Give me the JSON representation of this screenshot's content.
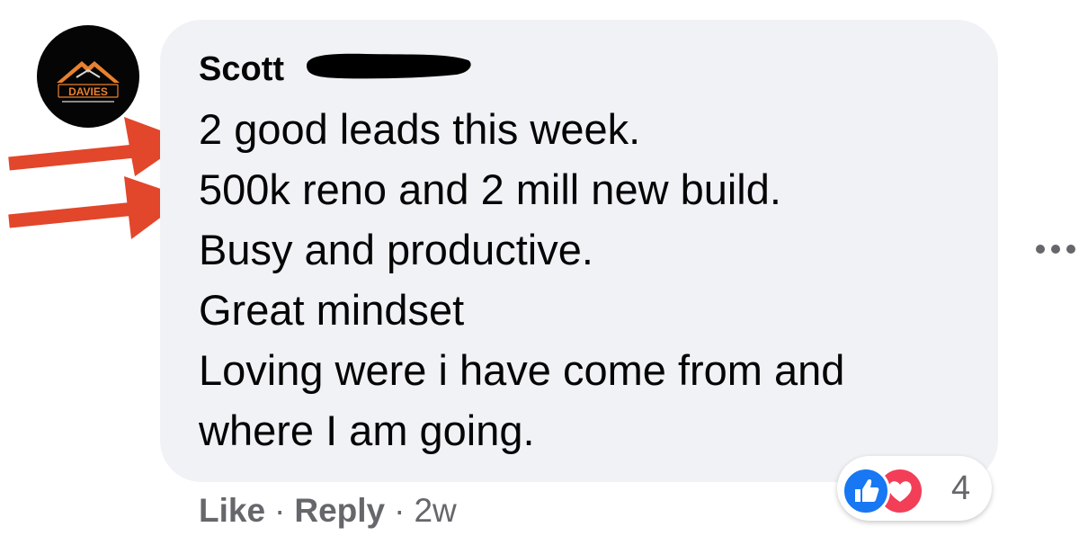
{
  "avatar": {
    "brand_text": "DAVIES",
    "brand_color": "#e8812f"
  },
  "comment": {
    "author": "Scott",
    "lines": [
      "2 good leads this week.",
      "500k reno and 2 mill new build.",
      "Busy and productive.",
      "Great mindset",
      "Loving were i have come from and",
      "where I am going."
    ]
  },
  "annotations": {
    "arrow_color": "#e2462b"
  },
  "actions": {
    "like": "Like",
    "separator": "·",
    "reply": "Reply",
    "time": "2w"
  },
  "reactions": {
    "like_color": "#1877f2",
    "love_color": "#f33e58",
    "count": "4"
  },
  "more_menu_icon": "ellipsis-icon",
  "colors": {
    "bubble_bg": "#f0f2f5",
    "text": "#050505",
    "secondary_text": "#65676b"
  }
}
